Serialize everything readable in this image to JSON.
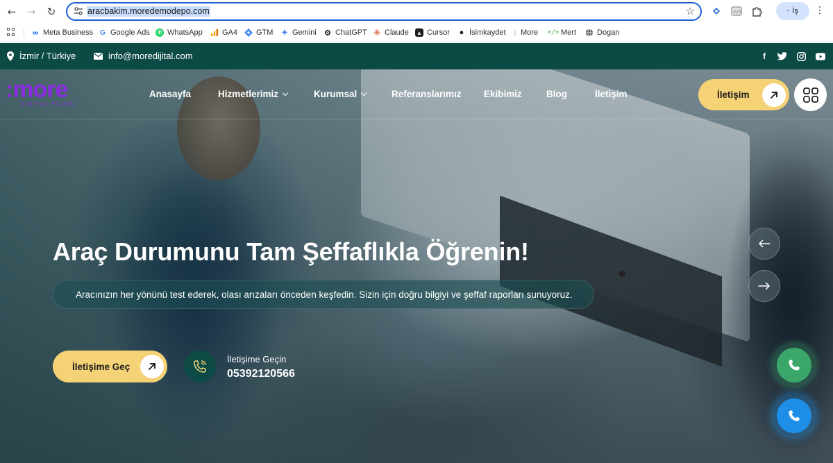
{
  "browser": {
    "url": "aracbakim.moredemodepo.com",
    "profile_label": "İş",
    "bookmarks": [
      {
        "label": "Meta Business",
        "icon": "meta-icon"
      },
      {
        "label": "Google Ads",
        "icon": "google-icon"
      },
      {
        "label": "WhatsApp",
        "icon": "whatsapp-icon"
      },
      {
        "label": "GA4",
        "icon": "analytics-icon"
      },
      {
        "label": "GTM",
        "icon": "tag-manager-icon"
      },
      {
        "label": "Gemini",
        "icon": "gemini-icon"
      },
      {
        "label": "ChatGPT",
        "icon": "openai-icon"
      },
      {
        "label": "Claude",
        "icon": "claude-icon"
      },
      {
        "label": "Cursor",
        "icon": "cursor-icon"
      },
      {
        "label": "İsimkaydet",
        "icon": "isimkaydet-icon"
      },
      {
        "label": "More",
        "icon": "dots-icon"
      },
      {
        "label": "Mert",
        "icon": "code-icon"
      },
      {
        "label": "Dogan",
        "icon": "globe-icon"
      }
    ]
  },
  "topbar": {
    "location": "İzmir / Türkiye",
    "email": "info@moredijital.com",
    "socials": [
      "facebook-icon",
      "twitter-icon",
      "instagram-icon",
      "youtube-icon"
    ],
    "bg_color": "#0c4a45"
  },
  "nav": {
    "logo_word": ":more",
    "logo_sub": "DIGITAL PLANS",
    "items": [
      "Anasayfa",
      "Hizmetlerimiz",
      "Kurumsal",
      "Referanslarımız",
      "Ekibimiz",
      "Blog",
      "İletişim"
    ],
    "cta_label": "İletişim"
  },
  "hero": {
    "title": "Araç Durumunu Tam Şeffaflıkla Öğrenin!",
    "subtitle": "Aracınızın her yönünü test ederek, olası arızaları önceden keşfedin. Sizin için doğru bilgiyi ve şeffaf raporları sunuyoruz.",
    "cta_label": "İletişime Geç",
    "contact_label": "İletişime Geçin",
    "contact_number": "05392120566"
  },
  "colors": {
    "accent_yellow": "#f5d276",
    "brand_purple": "#8b2be2",
    "dark_green": "#0c4a45",
    "whatsapp_green": "#3aa66a",
    "call_blue": "#1e8ee6"
  }
}
